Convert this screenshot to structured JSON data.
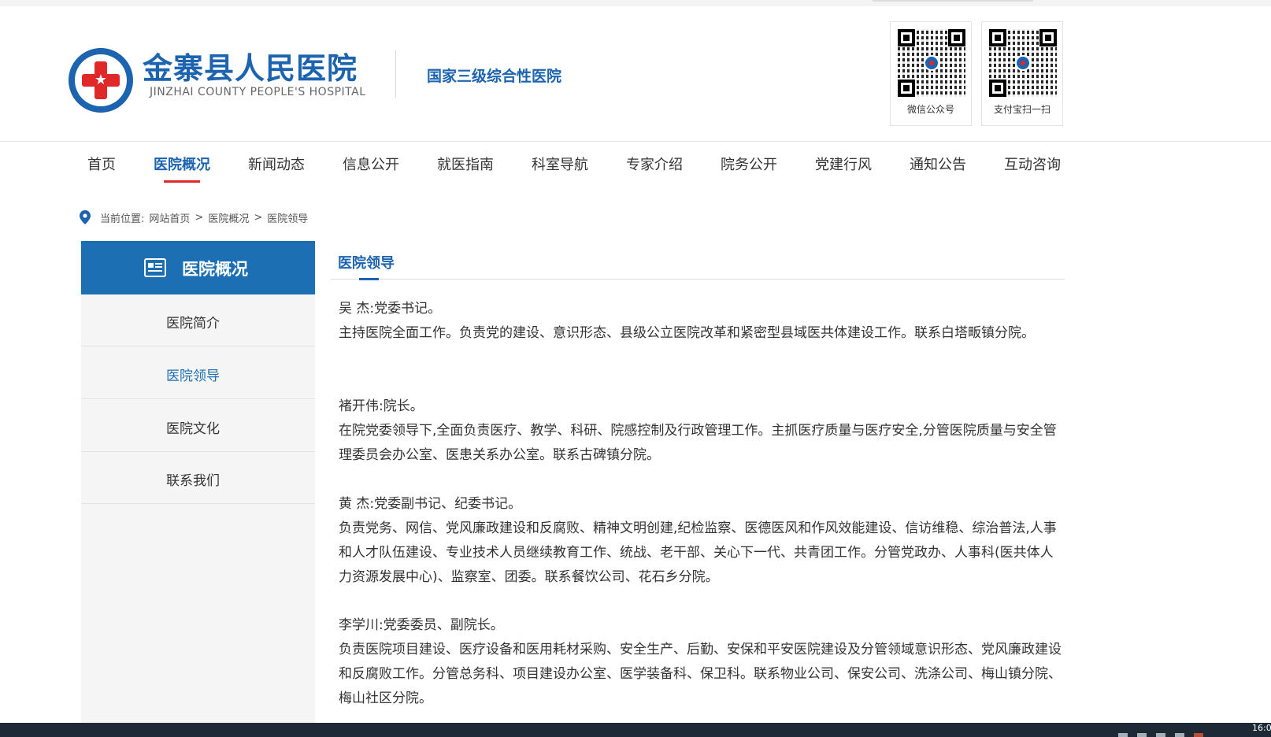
{
  "header": {
    "name": "金寨县人民医院",
    "name_en": "JINZHAI COUNTY PEOPLE'S HOSPITAL",
    "slogan": "国家三级综合性医院",
    "qr_codes": [
      {
        "caption": "微信公众号"
      },
      {
        "caption": "支付宝扫一扫"
      }
    ]
  },
  "nav": {
    "items": [
      "首页",
      "医院概况",
      "新闻动态",
      "信息公开",
      "就医指南",
      "科室导航",
      "专家介绍",
      "院务公开",
      "党建行风",
      "通知公告",
      "互动咨询"
    ],
    "active": "医院概况"
  },
  "breadcrumb": {
    "prefix": "当前位置:",
    "items": [
      "网站首页",
      "医院概况",
      "医院领导"
    ],
    "separator": ">"
  },
  "sidebar": {
    "title": "医院概况",
    "items": [
      {
        "label": "医院简介",
        "active": false
      },
      {
        "label": "医院领导",
        "active": true
      },
      {
        "label": "医院文化",
        "active": false
      },
      {
        "label": "联系我们",
        "active": false
      }
    ]
  },
  "content": {
    "title": "医院领导",
    "entries": [
      {
        "heading": "吴  杰:党委书记。",
        "body": "主持医院全面工作。负责党的建设、意识形态、县级公立医院改革和紧密型县域医共体建设工作。联系白塔畈镇分院。"
      },
      {
        "heading": "褚开伟:院长。",
        "body": "在院党委领导下,全面负责医疗、教学、科研、院感控制及行政管理工作。主抓医疗质量与医疗安全,分管医院质量与安全管理委员会办公室、医患关系办公室。联系古碑镇分院。"
      },
      {
        "heading": "黄  杰:党委副书记、纪委书记。",
        "body": "负责党务、网信、党风廉政建设和反腐败、精神文明创建,纪检监察、医德医风和作风效能建设、信访维稳、综治普法,人事和人才队伍建设、专业技术人员继续教育工作、统战、老干部、关心下一代、共青团工作。分管党政办、人事科(医共体人力资源发展中心)、监察室、团委。联系餐饮公司、花石乡分院。"
      },
      {
        "heading": "李学川:党委委员、副院长。",
        "body": "负责医院项目建设、医疗设备和医用耗材采购、安全生产、后勤、安保和平安医院建设及分管领域意识形态、党风廉政建设和反腐败工作。分管总务科、项目建设办公室、医学装备科、保卫科。联系物业公司、保安公司、洗涤公司、梅山镇分院、梅山社区分院。"
      }
    ]
  },
  "taskbar": {
    "time": "16:0"
  },
  "colors": {
    "brand_blue": "#1c63b0",
    "sidebar_blue": "#1c6fb3",
    "accent_red": "#e02828"
  }
}
